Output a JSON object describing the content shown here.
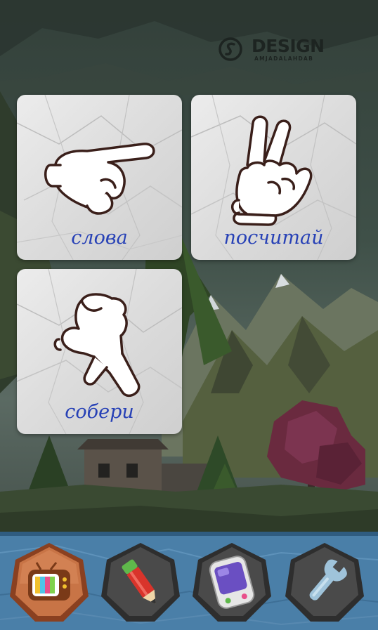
{
  "branding": {
    "logo_title": "DESIGN",
    "logo_subtitle": "AMJADALAHDAB"
  },
  "menu_cards": [
    {
      "label": "слова",
      "icon": "pointing-hand-icon"
    },
    {
      "label": "посчитай",
      "icon": "victory-hand-icon"
    },
    {
      "label": "собери",
      "icon": "walking-fingers-icon"
    }
  ],
  "bottom_nav": [
    {
      "id": "tv",
      "icon": "tv-icon",
      "active": true
    },
    {
      "id": "pencil",
      "icon": "pencil-icon",
      "active": false
    },
    {
      "id": "tablet",
      "icon": "tablet-icon",
      "active": false
    },
    {
      "id": "settings",
      "icon": "wrench-icon",
      "active": false
    }
  ],
  "colors": {
    "label_blue": "#2741b6",
    "bar_blue": "#4a7fa8",
    "active_button": "#b9653a",
    "inactive_button": "#4a4a4a"
  }
}
